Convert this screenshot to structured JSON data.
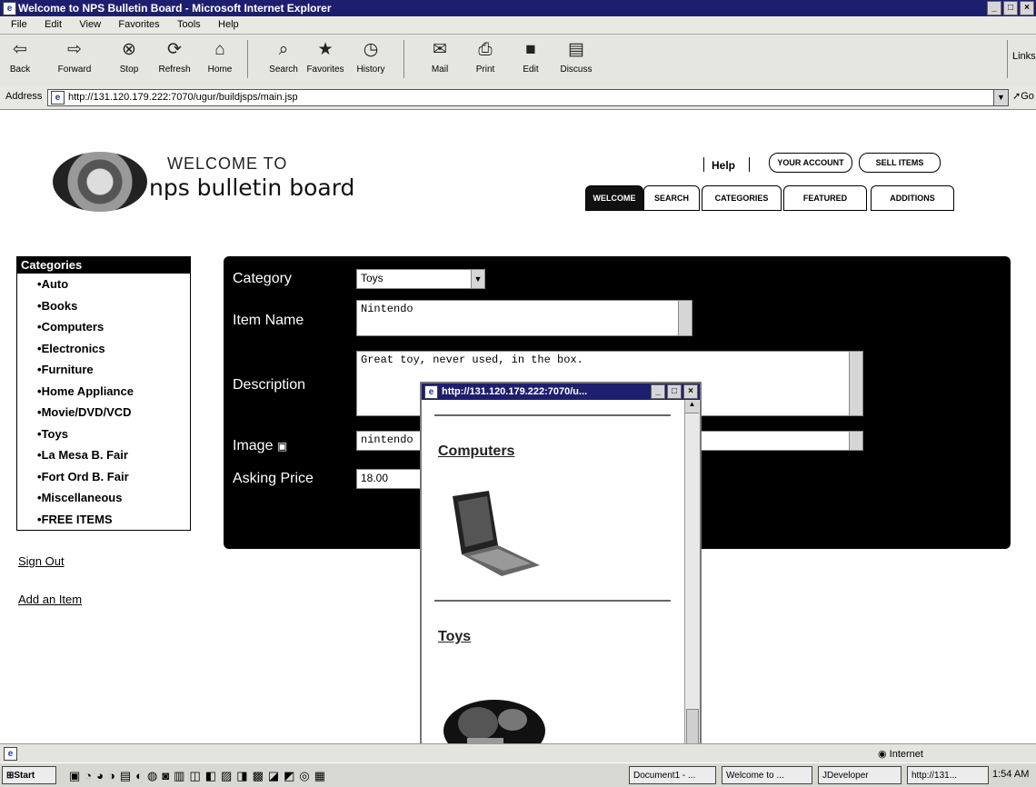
{
  "window": {
    "title": "Welcome to NPS Bulletin Board - Microsoft Internet Explorer"
  },
  "menu": [
    "File",
    "Edit",
    "View",
    "Favorites",
    "Tools",
    "Help"
  ],
  "toolbar": [
    "Back",
    "Forward",
    "Stop",
    "Refresh",
    "Home",
    "Search",
    "Favorites",
    "History",
    "Mail",
    "Print",
    "Edit",
    "Discuss"
  ],
  "links_label": "Links",
  "address": {
    "label": "Address",
    "url": "http://131.120.179.222:7070/ugur/buildjsps/main.jsp",
    "go": "Go"
  },
  "header": {
    "welcome_to": "WELCOME TO",
    "board_name": "nps bulletin board",
    "help": "Help",
    "your_account": "YOUR ACCOUNT",
    "sell_items": "SELL ITEMS",
    "tabs": [
      "WELCOME",
      "SEARCH",
      "CATEGORIES",
      "FEATURED",
      "ADDITIONS"
    ]
  },
  "sidebar": {
    "title": "Categories",
    "items": [
      "Auto",
      "Books",
      "Computers",
      "Electronics",
      "Furniture",
      "Home Appliance",
      "Movie/DVD/VCD",
      "Toys",
      "La Mesa B. Fair",
      "Fort Ord B. Fair",
      "Miscellaneous",
      "FREE ITEMS"
    ],
    "sign_out": "Sign Out",
    "add_item": "Add an Item"
  },
  "form": {
    "category_label": "Category",
    "category_value": "Toys",
    "item_name_label": "Item Name",
    "item_name_value": "Nintendo",
    "description_label": "Description",
    "description_value": "Great toy, never used, in the box.",
    "image_label": "Image",
    "image_value": "nintendo",
    "price_label": "Asking Price",
    "price_value": "18.00"
  },
  "popup": {
    "title": "http://131.120.179.222:7070/u...",
    "sections": [
      "Computers",
      "Toys"
    ]
  },
  "status": {
    "zone": "Internet"
  },
  "taskbar": {
    "start": "Start",
    "buttons": [
      "Document1 - ...",
      "Welcome to ...",
      "JDeveloper",
      "http://131..."
    ],
    "clock": "1:54 AM"
  }
}
